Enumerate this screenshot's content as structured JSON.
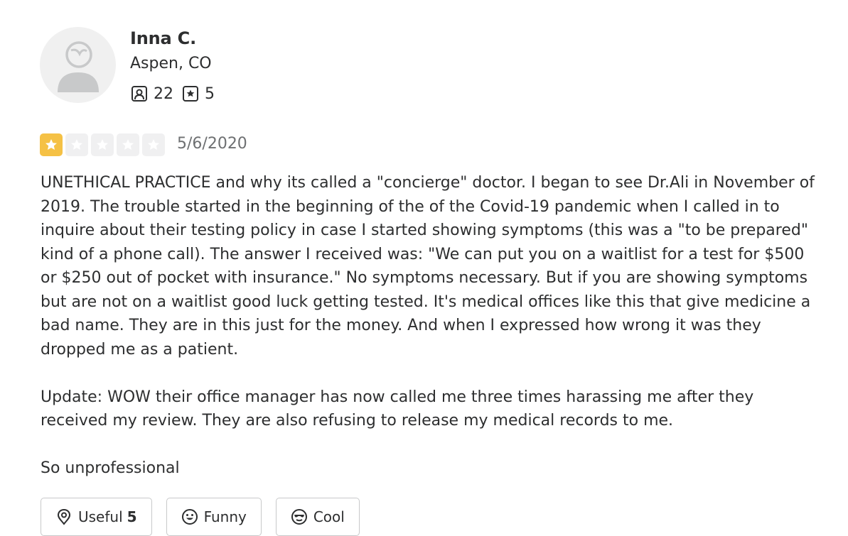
{
  "user": {
    "name": "Inna C.",
    "location": "Aspen, CO",
    "friends_count": "22",
    "reviews_count": "5"
  },
  "review": {
    "rating": 1,
    "max_rating": 5,
    "date": "5/6/2020",
    "paragraphs": [
      "UNETHICAL PRACTICE and why its called a \"concierge\" doctor. I began to see Dr.Ali in November of 2019. The trouble started in the beginning of the of the Covid-19 pandemic when I called in to inquire about their testing policy in case I started showing symptoms (this was a \"to be prepared\" kind of a phone call). The answer I received was: \"We can put you on a waitlist for a test for $500 or $250 out of pocket with insurance.\" No symptoms necessary. But if you are showing symptoms but are not on a waitlist good luck getting tested. It's medical offices like this that give medicine a bad name. They are in this just for the money. And when I expressed how wrong it was they dropped me as a patient.",
      "Update: WOW their office manager has now called me three times harassing me after they received my review. They are also refusing to release my medical records to me.",
      "So unprofessional"
    ]
  },
  "actions": {
    "useful_label": "Useful",
    "useful_count": "5",
    "funny_label": "Funny",
    "cool_label": "Cool"
  },
  "colors": {
    "star_filled": "#f5c145",
    "star_empty": "#f0f0f1",
    "text": "#2d2e2f"
  }
}
